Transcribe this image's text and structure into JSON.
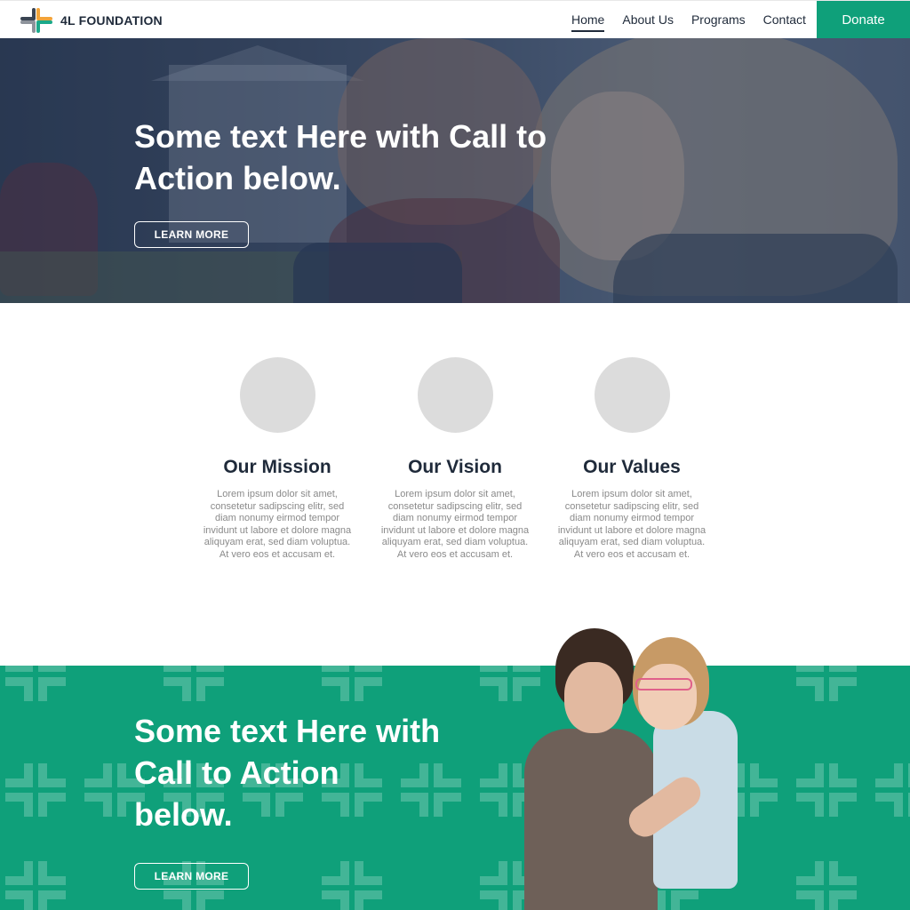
{
  "nav": {
    "logo_text": "4L FOUNDATION",
    "items": [
      {
        "label": "Home",
        "active": true
      },
      {
        "label": "About Us",
        "active": false
      },
      {
        "label": "Programs",
        "active": false
      },
      {
        "label": "Contact",
        "active": false
      }
    ],
    "donate_label": "Donate"
  },
  "hero": {
    "title": "Some text Here with Call to Action below.",
    "button_label": "LEARN MORE"
  },
  "features": [
    {
      "title": "Our Mission",
      "text": "Lorem ipsum dolor sit amet, consetetur sadipscing elitr, sed diam nonumy eirmod tempor invidunt ut labore et dolore magna aliquyam erat, sed diam voluptua. At vero eos et accusam et."
    },
    {
      "title": "Our Vision",
      "text": "Lorem ipsum dolor sit amet, consetetur sadipscing elitr, sed diam nonumy eirmod tempor invidunt ut labore et dolore magna aliquyam erat, sed diam voluptua. At vero eos et accusam et."
    },
    {
      "title": "Our Values",
      "text": "Lorem ipsum dolor sit amet, consetetur sadipscing elitr, sed diam nonumy eirmod tempor invidunt ut labore et dolore magna aliquyam erat, sed diam voluptua. At vero eos et accusam et."
    }
  ],
  "band": {
    "title": "Some text Here with Call to Action below.",
    "button_label": "LEARN MORE"
  },
  "colors": {
    "brand_green": "#0fa07a",
    "navy": "#1f2a3a",
    "logo_dark": "#3a4452",
    "logo_orange": "#f2a43a",
    "logo_gray": "#8d939b",
    "logo_teal": "#1ba98a"
  },
  "icons": {
    "logo_mark": "four-arm-cross-logo",
    "band_pattern": "bracket-cross-pattern"
  }
}
